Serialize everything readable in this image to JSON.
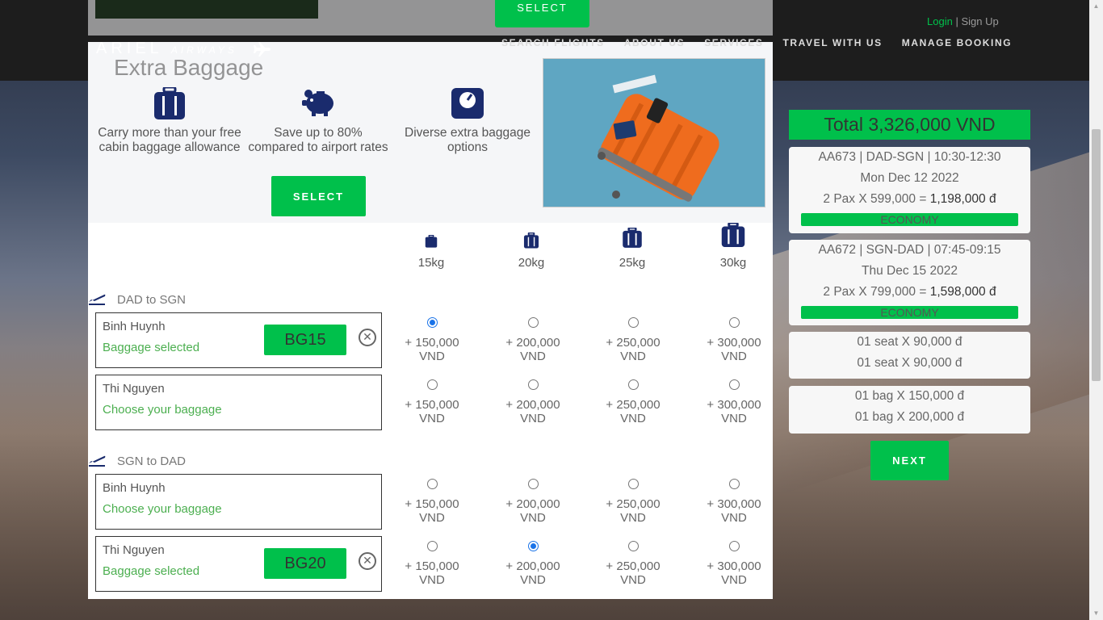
{
  "header": {
    "login": "Login",
    "separator": "|",
    "signup": "Sign Up",
    "logo_main": "ARIEL",
    "logo_sub": "AIRWAYS",
    "nav": [
      "SEARCH FLIGHTS",
      "ABOUT US",
      "SERVICES",
      "TRAVEL WITH US",
      "MANAGE BOOKING"
    ]
  },
  "prev_section": {
    "select_label": "SELECT"
  },
  "modal": {
    "title": "Extra Baggage",
    "features": [
      {
        "icon": "luggage-icon",
        "text": "Carry more than your free cabin baggage allowance"
      },
      {
        "icon": "piggy-bank-icon",
        "text": "Save up to 80% compared to airport rates"
      },
      {
        "icon": "scale-icon",
        "text": "Diverse extra baggage options"
      }
    ],
    "select_label": "SELECT",
    "weights": [
      "15kg",
      "20kg",
      "25kg",
      "30kg"
    ],
    "prices": [
      "+ 150,000 VND",
      "+ 200,000 VND",
      "+ 250,000 VND",
      "+ 300,000 VND"
    ],
    "routes": [
      {
        "label": "DAD to SGN",
        "passengers": [
          {
            "name": "Binh Huynh",
            "status": "Baggage selected",
            "code": "BG15",
            "selected": 0
          },
          {
            "name": "Thi Nguyen",
            "status": "Choose your baggage",
            "code": "",
            "selected": -1
          }
        ]
      },
      {
        "label": "SGN to DAD",
        "passengers": [
          {
            "name": "Binh Huynh",
            "status": "Choose your baggage",
            "code": "",
            "selected": -1
          },
          {
            "name": "Thi Nguyen",
            "status": "Baggage selected",
            "code": "BG20",
            "selected": 1
          }
        ]
      }
    ]
  },
  "summary": {
    "total": "Total 3,326,000 VND",
    "flights": [
      {
        "route": "AA673 | DAD-SGN | 10:30-12:30",
        "date": "Mon Dec 12 2022",
        "pax": "2 Pax X 599,000 =",
        "amount": "1,198,000 đ",
        "class": "ECONOMY"
      },
      {
        "route": "AA672 | SGN-DAD | 07:45-09:15",
        "date": "Thu Dec 15 2022",
        "pax": "2 Pax X 799,000 =",
        "amount": "1,598,000 đ",
        "class": "ECONOMY"
      }
    ],
    "seats": [
      "01 seat X 90,000 đ",
      "01 seat X 90,000 đ"
    ],
    "bags": [
      "01 bag X 150,000 đ",
      "01 bag X 200,000 đ"
    ],
    "next_label": "NEXT"
  },
  "colors": {
    "accent": "#00c04b",
    "navy": "#1a2b6d",
    "topbar": "#1d1d1d"
  }
}
